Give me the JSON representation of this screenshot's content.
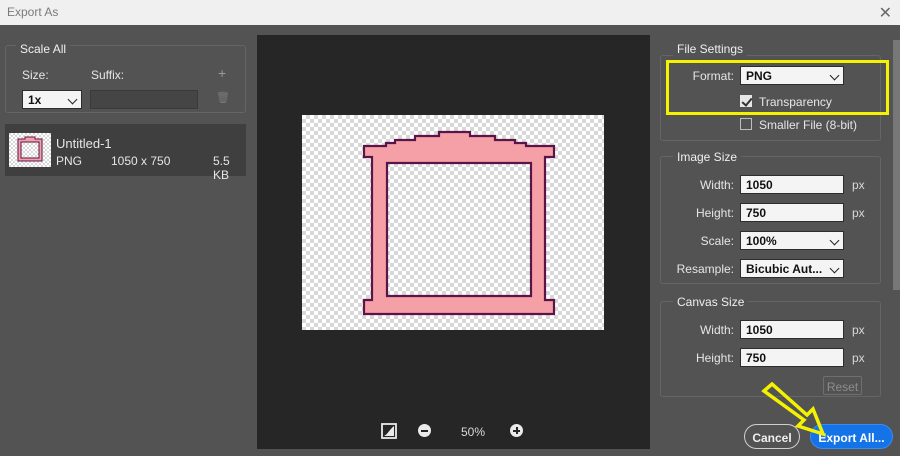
{
  "window": {
    "title": "Export As",
    "close_glyph": "✕"
  },
  "left_panel": {
    "section_title": "Scale All",
    "size_label": "Size:",
    "suffix_label": "Suffix:",
    "add_glyph": "+",
    "delete_glyph": "🗑",
    "scale_value": "1x",
    "suffix_value": "",
    "asset": {
      "name": "Untitled-1",
      "format": "PNG",
      "dimensions": "1050 x 750",
      "filesize": "5.5 KB"
    }
  },
  "preview": {
    "zoom": "50%"
  },
  "file_settings": {
    "section_title": "File Settings",
    "format_label": "Format:",
    "format_value": "PNG",
    "transparency_label": "Transparency",
    "transparency_checked": true,
    "smaller_file_label": "Smaller File (8-bit)",
    "smaller_file_checked": false
  },
  "image_size": {
    "section_title": "Image Size",
    "width_label": "Width:",
    "width_value": "1050",
    "width_unit": "px",
    "height_label": "Height:",
    "height_value": "750",
    "height_unit": "px",
    "scale_label": "Scale:",
    "scale_value": "100%",
    "resample_label": "Resample:",
    "resample_value": "Bicubic Aut..."
  },
  "canvas_size": {
    "section_title": "Canvas Size",
    "width_label": "Width:",
    "width_value": "1050",
    "width_unit": "px",
    "height_label": "Height:",
    "height_value": "750",
    "height_unit": "px",
    "reset_label": "Reset"
  },
  "footer": {
    "cancel_label": "Cancel",
    "export_label": "Export All..."
  },
  "colors": {
    "highlight": "#f4f200",
    "accent": "#1473e6",
    "frame_fill": "#f4a0a6",
    "frame_stroke": "#5b1448"
  }
}
